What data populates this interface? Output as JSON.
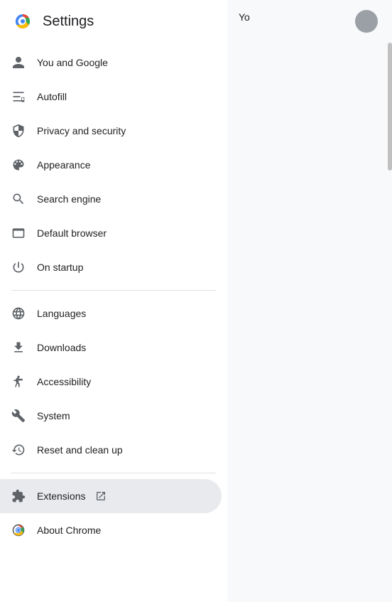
{
  "header": {
    "title": "Settings"
  },
  "nav": {
    "groups": [
      {
        "items": [
          {
            "id": "you-and-google",
            "label": "You and Google",
            "icon": "person"
          },
          {
            "id": "autofill",
            "label": "Autofill",
            "icon": "autofill"
          },
          {
            "id": "privacy-and-security",
            "label": "Privacy and security",
            "icon": "shield"
          },
          {
            "id": "appearance",
            "label": "Appearance",
            "icon": "palette"
          },
          {
            "id": "search-engine",
            "label": "Search engine",
            "icon": "search"
          },
          {
            "id": "default-browser",
            "label": "Default browser",
            "icon": "browser"
          },
          {
            "id": "on-startup",
            "label": "On startup",
            "icon": "power"
          }
        ]
      },
      {
        "items": [
          {
            "id": "languages",
            "label": "Languages",
            "icon": "globe"
          },
          {
            "id": "downloads",
            "label": "Downloads",
            "icon": "download"
          },
          {
            "id": "accessibility",
            "label": "Accessibility",
            "icon": "accessibility"
          },
          {
            "id": "system",
            "label": "System",
            "icon": "system"
          },
          {
            "id": "reset-and-clean-up",
            "label": "Reset and clean up",
            "icon": "reset"
          }
        ]
      },
      {
        "items": [
          {
            "id": "extensions",
            "label": "Extensions",
            "icon": "extensions",
            "external": true,
            "active": true
          },
          {
            "id": "about-chrome",
            "label": "About Chrome",
            "icon": "chrome"
          }
        ]
      }
    ]
  },
  "right_panel": {
    "text": "Yo"
  }
}
